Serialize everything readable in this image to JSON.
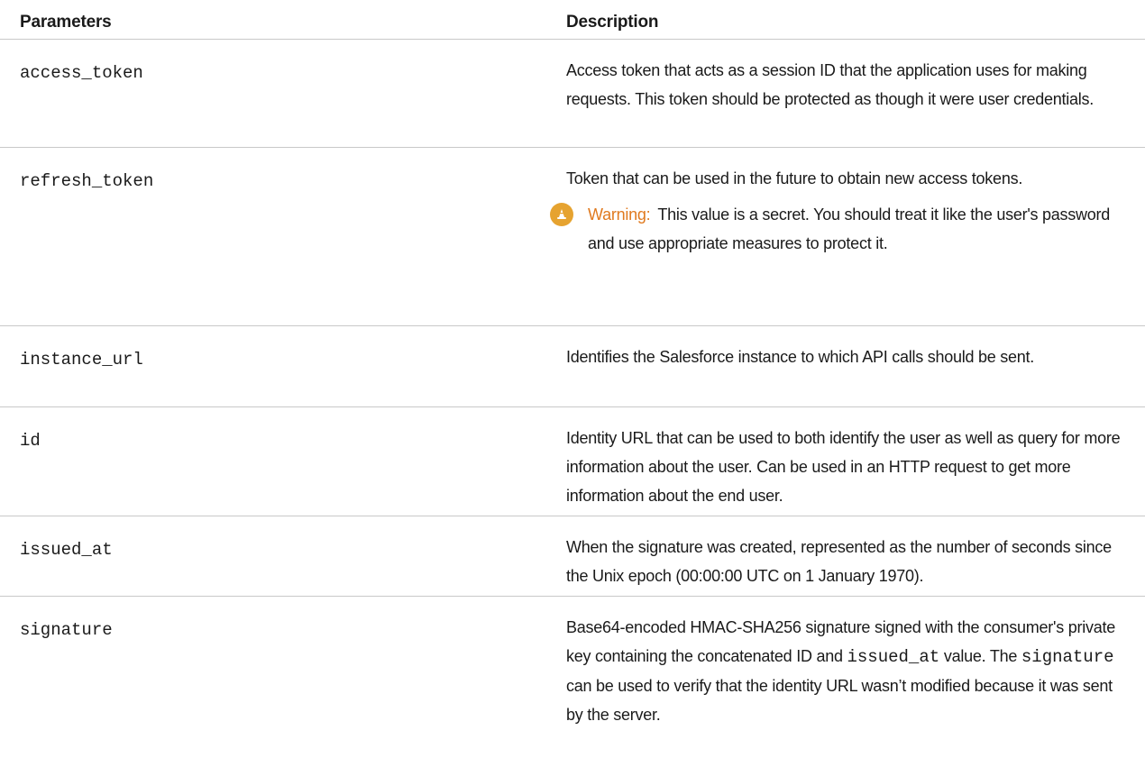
{
  "table": {
    "headers": {
      "parameters": "Parameters",
      "description": "Description"
    },
    "rows": [
      {
        "param": "access_token",
        "description": "Access token that acts as a session ID that the application uses for making requests. This token should be protected as though it were user credentials."
      },
      {
        "param": "refresh_token",
        "description": "Token that can be used in the future to obtain new access tokens.",
        "warning_label": "Warning:",
        "warning_text": "This value is a secret. You should treat it like the user's password and use appropriate measures to protect it."
      },
      {
        "param": "instance_url",
        "description": "Identifies the Salesforce instance to which API calls should be sent."
      },
      {
        "param": "id",
        "description": "Identity URL that can be used to both identify the user as well as query for more information about the user. Can be used in an HTTP request to get more information about the end user."
      },
      {
        "param": "issued_at",
        "description": "When the signature was created, represented as the number of seconds since the Unix epoch (00:00:00 UTC on 1 January 1970)."
      },
      {
        "param": "signature",
        "description_part1": "Base64-encoded HMAC-SHA256 signature signed with the consumer's private key containing the concatenated ID and",
        "description_code1": "issued_at",
        "description_part2": "value. The",
        "description_code2": "signature",
        "description_part3": "can be used to verify that the identity URL wasn’t modified because it was sent by the server."
      }
    ]
  },
  "colors": {
    "warning_icon": "#e6a330",
    "warning_label": "#e07a1f",
    "divider": "#c9c9c9"
  },
  "icons": {
    "warning": "warning-cone-icon"
  }
}
